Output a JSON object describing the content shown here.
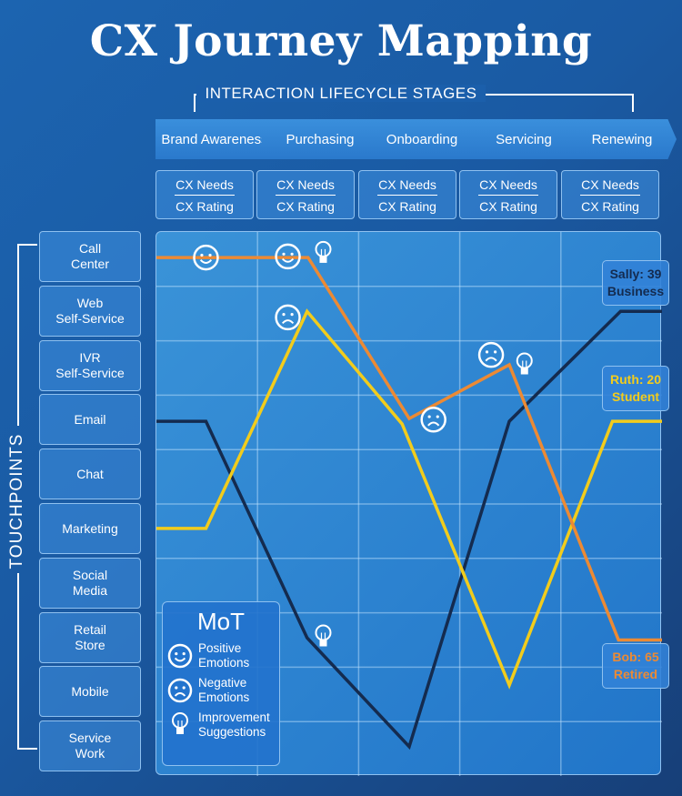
{
  "title": "CX Journey Mapping",
  "stages_label": "INTERACTION LIFECYCLE STAGES",
  "stages": [
    "Brand Awareness",
    "Purchasing",
    "Onboarding",
    "Servicing",
    "Renewing"
  ],
  "needs": {
    "top": "CX Needs",
    "bottom": "CX Rating"
  },
  "touchpoints_label": "TOUCHPOINTS",
  "touchpoints": [
    "Call\nCenter",
    "Web\nSelf-Service",
    "IVR\nSelf-Service",
    "Email",
    "Chat",
    "Marketing",
    "Social\nMedia",
    "Retail\nStore",
    "Mobile",
    "Service\nWork"
  ],
  "personas": [
    {
      "name": "Sally: 39",
      "role": "Business",
      "color": "#142b4f",
      "points": [
        [
          0,
          3.48
        ],
        [
          0.49,
          3.48
        ],
        [
          1.49,
          7.46
        ],
        [
          2.5,
          9.46
        ],
        [
          3.49,
          3.48
        ],
        [
          4.59,
          1.46
        ],
        [
          5,
          1.46
        ]
      ]
    },
    {
      "name": "Ruth: 20",
      "role": "Student",
      "color": "#f2cc1c",
      "points": [
        [
          0,
          5.45
        ],
        [
          0.49,
          5.45
        ],
        [
          1.49,
          1.46
        ],
        [
          2.43,
          3.53
        ],
        [
          3.49,
          8.33
        ],
        [
          4.51,
          3.48
        ],
        [
          5,
          3.48
        ]
      ]
    },
    {
      "name": "Bob: 65",
      "role": "Retired",
      "color": "#ec8a34",
      "points": [
        [
          0,
          0.47
        ],
        [
          1.5,
          0.47
        ],
        [
          2.5,
          3.43
        ],
        [
          3.49,
          2.44
        ],
        [
          4.57,
          7.5
        ],
        [
          5,
          7.5
        ]
      ]
    }
  ],
  "markers": [
    {
      "type": "smile-icon",
      "at": [
        0.49,
        0.47
      ]
    },
    {
      "type": "smile-icon",
      "at": [
        1.3,
        0.45
      ]
    },
    {
      "type": "bulb-icon",
      "at": [
        1.65,
        0.4
      ]
    },
    {
      "type": "frown-icon",
      "at": [
        1.3,
        1.57
      ]
    },
    {
      "type": "frown-icon",
      "at": [
        3.31,
        2.26
      ]
    },
    {
      "type": "bulb-icon",
      "at": [
        3.64,
        2.45
      ]
    },
    {
      "type": "frown-icon",
      "at": [
        2.74,
        3.45
      ]
    },
    {
      "type": "bulb-icon",
      "at": [
        1.65,
        7.45
      ]
    }
  ],
  "legend": {
    "title": "MoT",
    "items": [
      "Positive\nEmotions",
      "Negative\nEmotions",
      "Improvement\nSuggestions"
    ]
  }
}
